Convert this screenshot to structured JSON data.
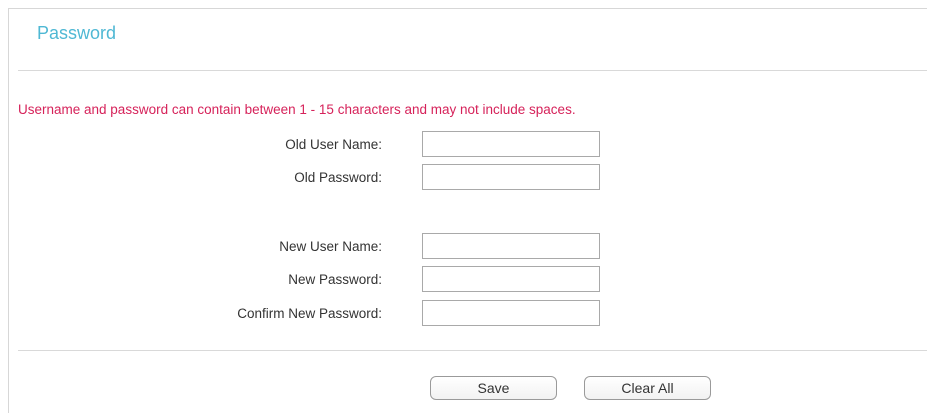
{
  "page": {
    "title": "Password",
    "notice": "Username and password can contain between 1 - 15 characters and may not include spaces."
  },
  "form": {
    "old_user_name": {
      "label": "Old User Name:",
      "value": ""
    },
    "old_password": {
      "label": "Old Password:",
      "value": ""
    },
    "new_user_name": {
      "label": "New User Name:",
      "value": ""
    },
    "new_password": {
      "label": "New Password:",
      "value": ""
    },
    "confirm_new_password": {
      "label": "Confirm New Password:",
      "value": ""
    }
  },
  "buttons": {
    "save": "Save",
    "clear_all": "Clear All"
  },
  "colors": {
    "title": "#4fb8d4",
    "notice": "#d6225a",
    "divider": "#d9d9d9"
  }
}
